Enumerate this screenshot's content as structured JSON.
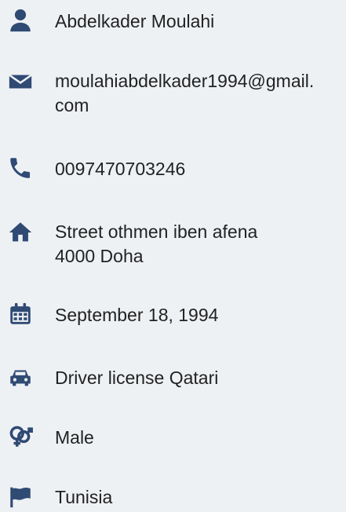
{
  "profile": {
    "name": "Abdelkader Moulahi",
    "email_line1": "moulahiabdelkader1994@gmail.",
    "email_line2": "com",
    "phone": "0097470703246",
    "address_line1": "Street othmen iben afena",
    "address_line2": "4000 Doha",
    "birthdate": "September 18, 1994",
    "license": "Driver license Qatari",
    "gender": "Male",
    "nationality": "Tunisia"
  },
  "icons": {
    "name": "user-icon",
    "email": "envelope-icon",
    "phone": "phone-icon",
    "address": "home-icon",
    "birthdate": "calendar-icon",
    "license": "car-icon",
    "gender": "gender-icon",
    "nationality": "flag-icon"
  },
  "colors": {
    "background": "#eef1f4",
    "icon": "#2f4a73",
    "text": "#222222"
  }
}
